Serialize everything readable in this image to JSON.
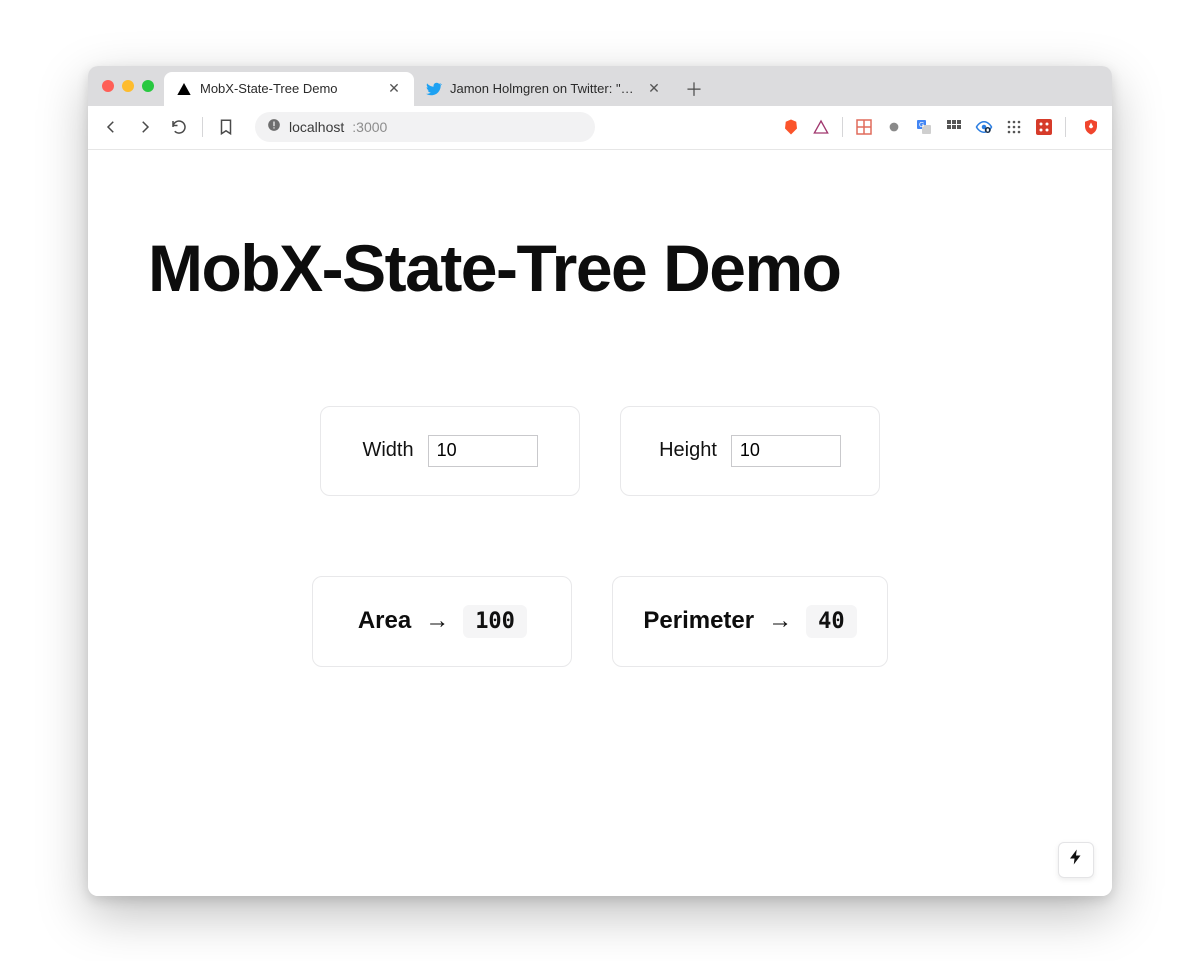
{
  "chrome": {
    "tabs": [
      {
        "title": "MobX-State-Tree Demo",
        "active": true,
        "favicon": "vercel"
      },
      {
        "title": "Jamon Holmgren on Twitter: \"Who",
        "active": false,
        "favicon": "twitter"
      }
    ],
    "address": {
      "host": "localhost",
      "port": ":3000"
    }
  },
  "page": {
    "title": "MobX-State-Tree Demo",
    "inputs": {
      "width": {
        "label": "Width",
        "value": "10"
      },
      "height": {
        "label": "Height",
        "value": "10"
      }
    },
    "results": {
      "area": {
        "label": "Area",
        "value": "100"
      },
      "perimeter": {
        "label": "Perimeter",
        "value": "40"
      }
    },
    "arrow": "→"
  }
}
